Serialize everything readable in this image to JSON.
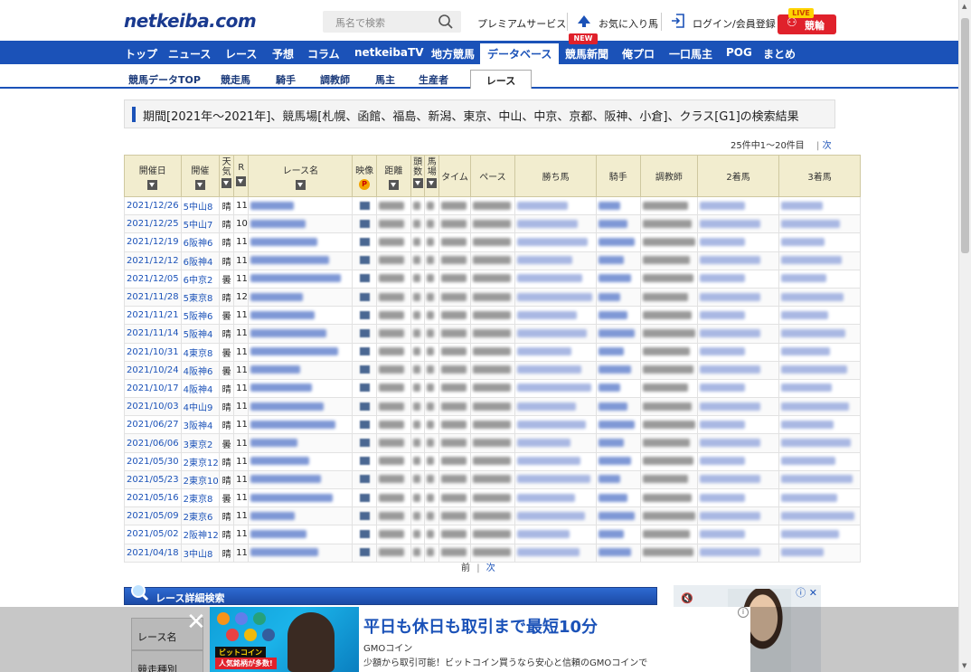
{
  "header": {
    "logo": "netkeiba.com",
    "search_placeholder": "馬名で検索",
    "premium": "プレミアムサービス",
    "favorite": "お気に入り馬",
    "login": "ログイン/会員登録",
    "live_badge": "LIVE",
    "keirin": "競輪"
  },
  "global_nav": [
    "トップ",
    "ニュース",
    "レース",
    "予想",
    "コラム",
    "netkeibaTV",
    "地方競馬",
    "データベース",
    "競馬新聞",
    "俺プロ",
    "一口馬主",
    "POG",
    "まとめ"
  ],
  "global_nav_active": "データベース",
  "new_badge": "NEW",
  "sub_nav": [
    "競馬データTOP",
    "競走馬",
    "騎手",
    "調教師",
    "馬主",
    "生産者"
  ],
  "sub_nav_active": "レース",
  "search_title": "期間[2021年～2021年]、競馬場[札幌、函館、福島、新潟、東京、中山、中京、京都、阪神、小倉]、クラス[G1]の検索結果",
  "count": {
    "text": "25件中1～20件目",
    "next": "次"
  },
  "table": {
    "headers": {
      "date": "開催日",
      "place": "開催",
      "weather": "天気",
      "r": "R",
      "race": "レース名",
      "video": "映像",
      "distance": "距離",
      "heads": "頭数",
      "horse_no": "馬場",
      "time": "タイム",
      "pace": "ペース",
      "winner": "勝ち馬",
      "jockey": "騎手",
      "trainer": "調教師",
      "second": "2着馬",
      "third": "3着馬"
    },
    "rows": [
      {
        "date": "2021/12/26",
        "place": "5中山8",
        "weather": "晴",
        "r": "11"
      },
      {
        "date": "2021/12/25",
        "place": "5中山7",
        "weather": "晴",
        "r": "10"
      },
      {
        "date": "2021/12/19",
        "place": "6阪神6",
        "weather": "晴",
        "r": "11"
      },
      {
        "date": "2021/12/12",
        "place": "6阪神4",
        "weather": "晴",
        "r": "11"
      },
      {
        "date": "2021/12/05",
        "place": "6中京2",
        "weather": "曇",
        "r": "11"
      },
      {
        "date": "2021/11/28",
        "place": "5東京8",
        "weather": "晴",
        "r": "12"
      },
      {
        "date": "2021/11/21",
        "place": "5阪神6",
        "weather": "曇",
        "r": "11"
      },
      {
        "date": "2021/11/14",
        "place": "5阪神4",
        "weather": "晴",
        "r": "11"
      },
      {
        "date": "2021/10/31",
        "place": "4東京8",
        "weather": "曇",
        "r": "11"
      },
      {
        "date": "2021/10/24",
        "place": "4阪神6",
        "weather": "曇",
        "r": "11"
      },
      {
        "date": "2021/10/17",
        "place": "4阪神4",
        "weather": "晴",
        "r": "11"
      },
      {
        "date": "2021/10/03",
        "place": "4中山9",
        "weather": "晴",
        "r": "11"
      },
      {
        "date": "2021/06/27",
        "place": "3阪神4",
        "weather": "晴",
        "r": "11"
      },
      {
        "date": "2021/06/06",
        "place": "3東京2",
        "weather": "曇",
        "r": "11"
      },
      {
        "date": "2021/05/30",
        "place": "2東京12",
        "weather": "晴",
        "r": "11"
      },
      {
        "date": "2021/05/23",
        "place": "2東京10",
        "weather": "晴",
        "r": "11"
      },
      {
        "date": "2021/05/16",
        "place": "2東京8",
        "weather": "曇",
        "r": "11"
      },
      {
        "date": "2021/05/09",
        "place": "2東京6",
        "weather": "晴",
        "r": "11"
      },
      {
        "date": "2021/05/02",
        "place": "2阪神12",
        "weather": "晴",
        "r": "11"
      },
      {
        "date": "2021/04/18",
        "place": "3中山8",
        "weather": "晴",
        "r": "11"
      }
    ]
  },
  "pager": {
    "prev": "前",
    "sep": "|",
    "next": "次"
  },
  "detail_search": {
    "title": "レース詳細検索",
    "race_name_label": "レース名",
    "race_type_label": "競走種別"
  },
  "ad": {
    "headline": "平日も休日も取引まで最短10分",
    "brand": "GMOコイン",
    "desc": "少額から取引可能！ビットコイン買うなら安心と信頼のGMOコインで",
    "tag1": "ビットコイン",
    "tag2": "人気銘柄が多数!"
  },
  "colors": {
    "nav_blue": "#1b52b8",
    "logo_blue": "#1a3a8f",
    "keirin_red": "#e0212b",
    "table_header": "#f2edcf"
  }
}
